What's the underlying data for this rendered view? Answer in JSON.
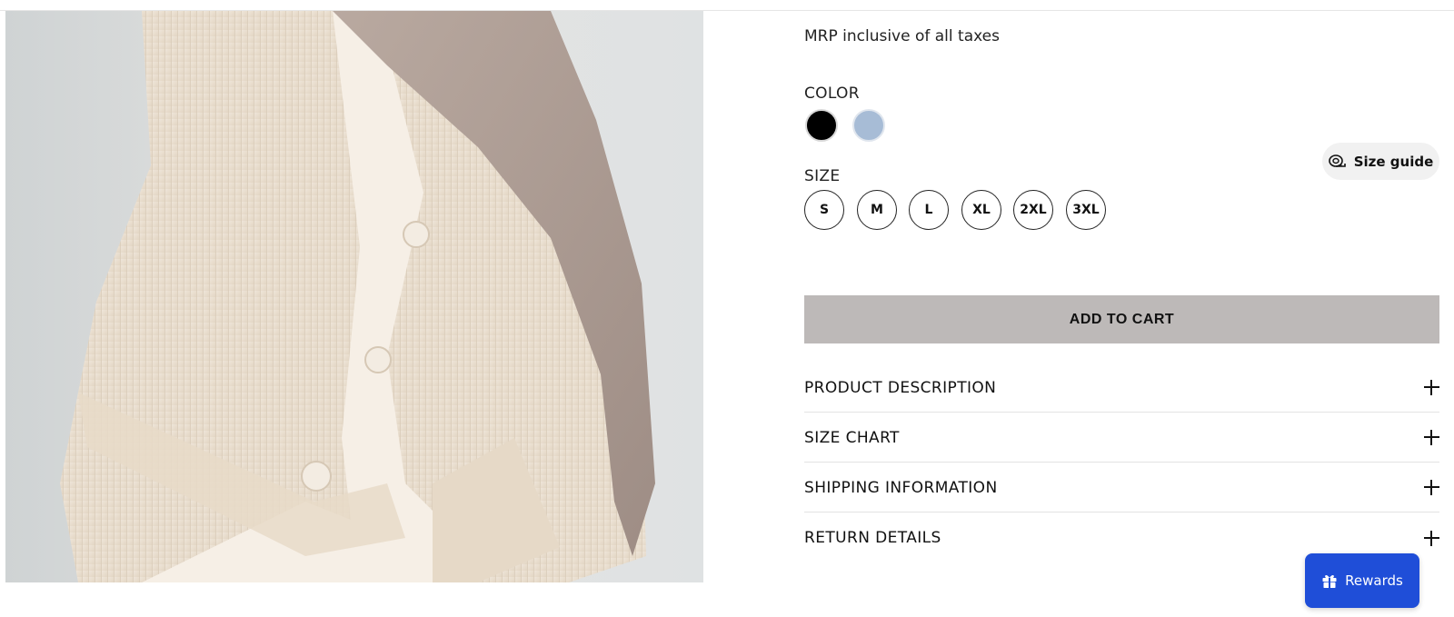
{
  "product": {
    "image_alt": "Cream ribbed knit cardigan with taupe scarf",
    "tax_note": "MRP inclusive of all taxes"
  },
  "color": {
    "label": "COLOR",
    "options": [
      {
        "name": "black",
        "hex": "#000000"
      },
      {
        "name": "light blue",
        "hex": "#a7bcd6"
      }
    ]
  },
  "size": {
    "label": "SIZE",
    "options": [
      "S",
      "M",
      "L",
      "XL",
      "2XL",
      "3XL"
    ]
  },
  "size_guide": {
    "label": "Size guide",
    "icon": "measuring-tape-icon"
  },
  "cart": {
    "label": "ADD TO CART",
    "bg": "#bdb9b8"
  },
  "accordion": [
    {
      "title": "PRODUCT DESCRIPTION"
    },
    {
      "title": "SIZE CHART"
    },
    {
      "title": "SHIPPING INFORMATION"
    },
    {
      "title": "RETURN DETAILS"
    }
  ],
  "rewards": {
    "label": "Rewards",
    "icon": "gift-icon",
    "bg": "#1f4ed8"
  }
}
